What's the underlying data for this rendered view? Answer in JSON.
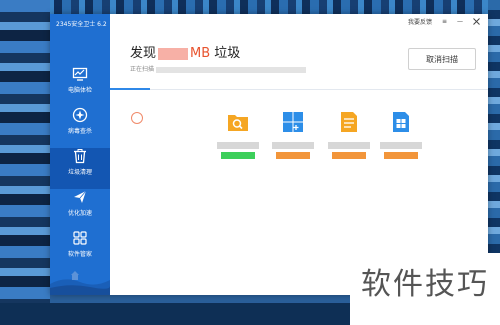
{
  "app": {
    "title": "2345安全卫士 6.2"
  },
  "topbar": {
    "feedback_label": "我要反馈",
    "menu_glyph": "≡",
    "minimize_glyph": "—"
  },
  "sidebar": {
    "items": [
      {
        "label": "电脑体检",
        "icon": "monitor-icon",
        "active": false
      },
      {
        "label": "病毒查杀",
        "icon": "shield-icon",
        "active": false
      },
      {
        "label": "垃圾清理",
        "icon": "trash-icon",
        "active": true
      },
      {
        "label": "优化加速",
        "icon": "rocket-icon",
        "active": false
      },
      {
        "label": "软件管家",
        "icon": "grid-icon",
        "active": false
      }
    ]
  },
  "scan": {
    "prefix": "发现",
    "unit": "MB",
    "suffix": " 垃圾",
    "status_label": "正在扫描",
    "cancel_label": "取消扫描"
  },
  "categories": [
    {
      "icon": "search-folder-icon",
      "color": "#f5a623",
      "bar_color": "#3ccf5a"
    },
    {
      "icon": "windows-icon",
      "color": "#2d8ee8",
      "bar_color": "#f2953a"
    },
    {
      "icon": "document-icon",
      "color": "#f5a623",
      "bar_color": "#f2953a"
    },
    {
      "icon": "windows-file-icon",
      "color": "#2d8ee8",
      "bar_color": "#f2953a"
    }
  ],
  "watermark": {
    "text": "软件技巧"
  },
  "colors": {
    "sidebar": "#1f6fd1",
    "sidebar_active": "#1356b2",
    "accent": "#e8542f",
    "progress": "#2f88e8"
  }
}
